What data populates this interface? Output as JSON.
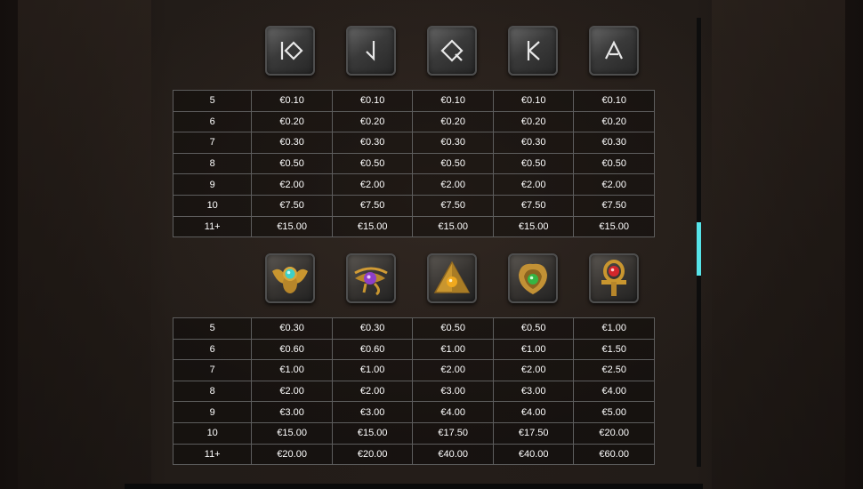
{
  "colors": {
    "accent_scrollbar": "#56e3e8",
    "table_border": "#5d5d5d",
    "text": "#ffffff"
  },
  "low_symbols": [
    "rune-10-icon",
    "rune-j-icon",
    "rune-q-icon",
    "rune-k-icon",
    "rune-a-icon"
  ],
  "high_symbols": [
    "scarab-teal-gem-icon",
    "eye-of-horus-purple-gem-icon",
    "pyramid-amber-gem-icon",
    "cobra-green-gem-icon",
    "ankh-red-gem-icon"
  ],
  "low_table": {
    "rows": [
      {
        "count": "5",
        "values": [
          "€0.10",
          "€0.10",
          "€0.10",
          "€0.10",
          "€0.10"
        ]
      },
      {
        "count": "6",
        "values": [
          "€0.20",
          "€0.20",
          "€0.20",
          "€0.20",
          "€0.20"
        ]
      },
      {
        "count": "7",
        "values": [
          "€0.30",
          "€0.30",
          "€0.30",
          "€0.30",
          "€0.30"
        ]
      },
      {
        "count": "8",
        "values": [
          "€0.50",
          "€0.50",
          "€0.50",
          "€0.50",
          "€0.50"
        ]
      },
      {
        "count": "9",
        "values": [
          "€2.00",
          "€2.00",
          "€2.00",
          "€2.00",
          "€2.00"
        ]
      },
      {
        "count": "10",
        "values": [
          "€7.50",
          "€7.50",
          "€7.50",
          "€7.50",
          "€7.50"
        ]
      },
      {
        "count": "11+",
        "values": [
          "€15.00",
          "€15.00",
          "€15.00",
          "€15.00",
          "€15.00"
        ]
      }
    ]
  },
  "high_table": {
    "rows": [
      {
        "count": "5",
        "values": [
          "€0.30",
          "€0.30",
          "€0.50",
          "€0.50",
          "€1.00"
        ]
      },
      {
        "count": "6",
        "values": [
          "€0.60",
          "€0.60",
          "€1.00",
          "€1.00",
          "€1.50"
        ]
      },
      {
        "count": "7",
        "values": [
          "€1.00",
          "€1.00",
          "€2.00",
          "€2.00",
          "€2.50"
        ]
      },
      {
        "count": "8",
        "values": [
          "€2.00",
          "€2.00",
          "€3.00",
          "€3.00",
          "€4.00"
        ]
      },
      {
        "count": "9",
        "values": [
          "€3.00",
          "€3.00",
          "€4.00",
          "€4.00",
          "€5.00"
        ]
      },
      {
        "count": "10",
        "values": [
          "€15.00",
          "€15.00",
          "€17.50",
          "€17.50",
          "€20.00"
        ]
      },
      {
        "count": "11+",
        "values": [
          "€20.00",
          "€20.00",
          "€40.00",
          "€40.00",
          "€60.00"
        ]
      }
    ]
  }
}
